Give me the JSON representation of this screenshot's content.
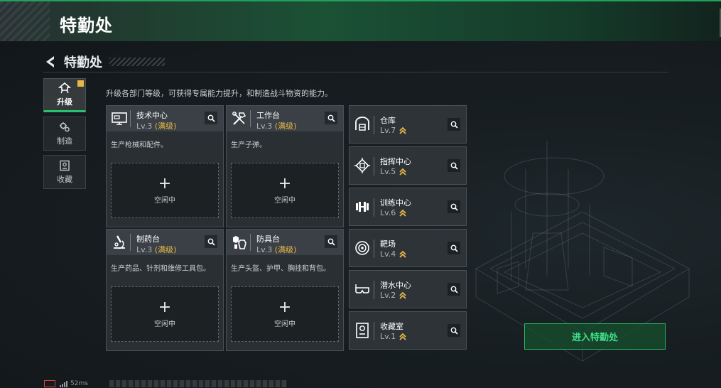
{
  "header": {
    "title": "特勤处"
  },
  "nav": {
    "back_title": "特勤处"
  },
  "tabs": [
    {
      "label": "升级",
      "icon": "upgrade-icon",
      "active": true
    },
    {
      "label": "制造",
      "icon": "gears-icon",
      "active": false
    },
    {
      "label": "收藏",
      "icon": "collection-icon",
      "active": false
    }
  ],
  "description": "升级各部门等级，可获得专属能力提升，和制造战斗物资的能力。",
  "workshops": [
    {
      "name": "技术中心",
      "level": "Lv.3",
      "max": "(满级)",
      "produce": "生产枪械和配件。",
      "slot_plus": "+",
      "slot_status": "空闲中",
      "icon": "computer-icon"
    },
    {
      "name": "工作台",
      "level": "Lv.3",
      "max": "(满级)",
      "produce": "生产子弹。",
      "slot_plus": "+",
      "slot_status": "空闲中",
      "icon": "tools-icon"
    },
    {
      "name": "制药台",
      "level": "Lv.3",
      "max": "(满级)",
      "produce": "生产药品、针剂和维修工具包。",
      "slot_plus": "+",
      "slot_status": "空闲中",
      "icon": "microscope-icon"
    },
    {
      "name": "防具台",
      "level": "Lv.3",
      "max": "(满级)",
      "produce": "生产头盔、护甲、胸挂和背包。",
      "slot_plus": "+",
      "slot_status": "空闲中",
      "icon": "armor-icon"
    }
  ],
  "departments": [
    {
      "name": "仓库",
      "level": "Lv.7",
      "icon": "warehouse-icon"
    },
    {
      "name": "指挥中心",
      "level": "Lv.5",
      "icon": "chip-icon"
    },
    {
      "name": "训练中心",
      "level": "Lv.6",
      "icon": "dumbbell-icon"
    },
    {
      "name": "靶场",
      "level": "Lv.4",
      "icon": "target-icon"
    },
    {
      "name": "潜水中心",
      "level": "Lv.2",
      "icon": "diving-mask-icon"
    },
    {
      "name": "收藏室",
      "level": "Lv.1",
      "icon": "trophy-icon"
    }
  ],
  "enter_button": "进入特勤处",
  "status": {
    "ping": "52ms"
  },
  "colors": {
    "accent": "#29c26b",
    "max_level": "#e7b84a",
    "card": "#2a2f33"
  }
}
